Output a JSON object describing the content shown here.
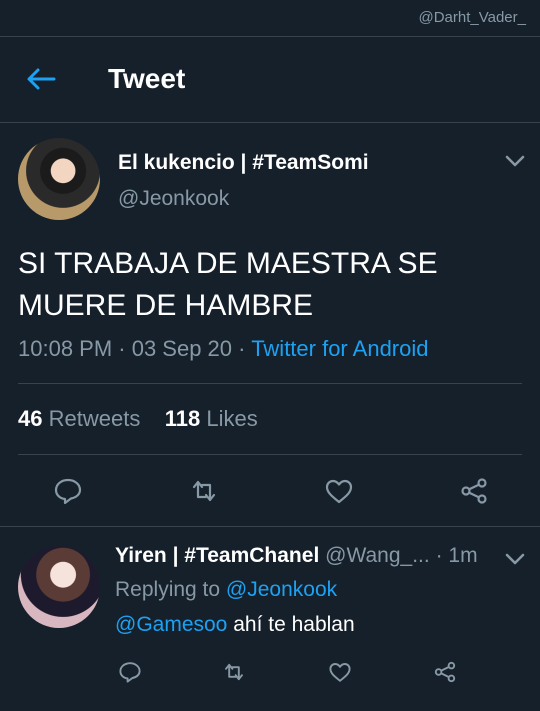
{
  "watermark": "@Darht_Vader_",
  "header": {
    "title": "Tweet"
  },
  "tweet": {
    "author_name": "El kukencio | #TeamSomi",
    "author_handle": "@Jeonkook",
    "text_line1": "SI TRABAJA DE MAESTRA SE",
    "text_line2": "MUERE DE HAMBRE",
    "time": "10:08 PM · 03 Sep 20 · ",
    "source": "Twitter for Android",
    "retweets_count": "46",
    "retweets_label": "Retweets",
    "likes_count": "118",
    "likes_label": "Likes"
  },
  "reply": {
    "author_name": "Yiren | #TeamChanel",
    "author_handle": "@Wang_...",
    "time": "· 1m",
    "replying_prefix": "Replying to",
    "replying_to": "@Jeonkook",
    "mention": "@Gamesoo",
    "text": "ahí te hablan"
  },
  "colors": {
    "background": "#15202b",
    "accent": "#1da1f2",
    "muted": "#8899a6",
    "divider": "#38444d"
  },
  "icons": [
    "back-arrow-icon",
    "chevron-down-icon",
    "reply-icon",
    "retweet-icon",
    "like-icon",
    "share-icon"
  ]
}
